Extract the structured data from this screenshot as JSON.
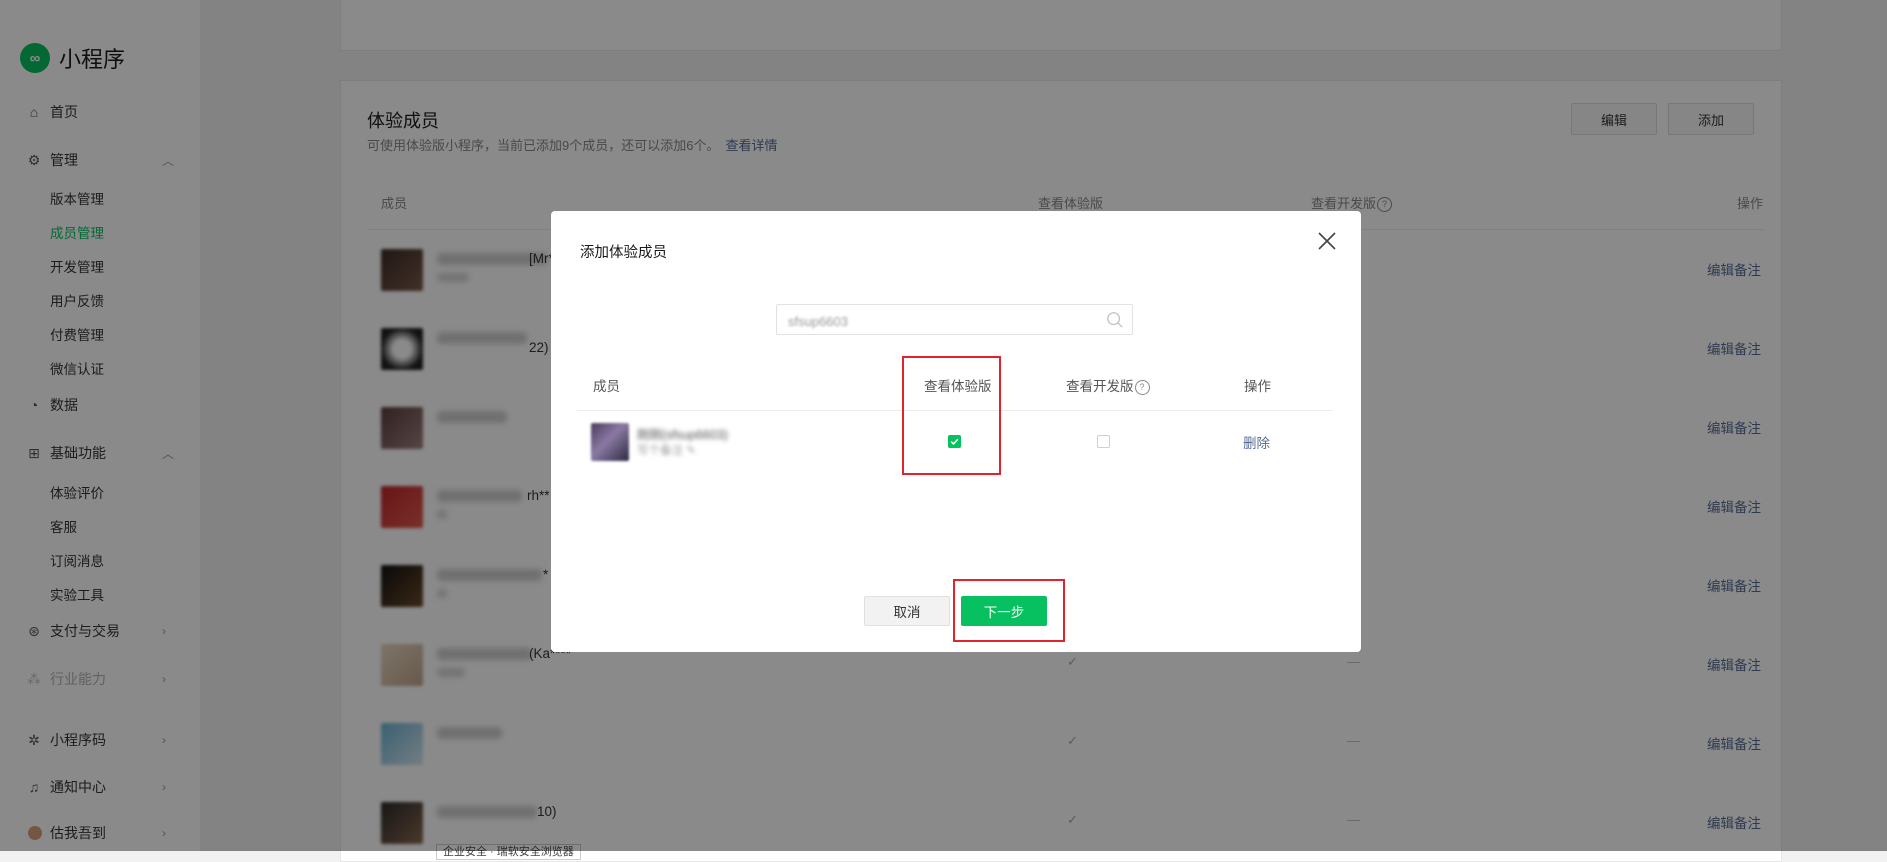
{
  "sidebar": {
    "app_name": "小程序",
    "nav": [
      {
        "label": "首页",
        "icon": "home-icon"
      },
      {
        "label": "管理",
        "icon": "settings-icon"
      },
      {
        "label": "数据",
        "icon": "chart-icon"
      },
      {
        "label": "基础功能",
        "icon": "grid-icon"
      },
      {
        "label": "支付与交易",
        "icon": "payment-icon"
      },
      {
        "label": "行业能力",
        "icon": "industry-icon"
      },
      {
        "label": "小程序码",
        "icon": "qrcode-icon"
      },
      {
        "label": "通知中心",
        "icon": "bell-icon"
      },
      {
        "label": "估我吾到",
        "icon": "avatar"
      }
    ],
    "manage_sub": [
      "版本管理",
      "成员管理",
      "开发管理",
      "用户反馈",
      "付费管理",
      "微信认证"
    ],
    "basic_sub": [
      "体验评价",
      "客服",
      "订阅消息",
      "实验工具"
    ]
  },
  "panel": {
    "title": "体验成员",
    "desc": "可使用体验版小程序，当前已添加9个成员，还可以添加6个。",
    "details_link": "查看详情",
    "edit_button": "编辑",
    "add_button": "添加",
    "columns": {
      "member": "成员",
      "view_trial": "查看体验版",
      "view_dev": "查看开发版",
      "action": "操作"
    },
    "row_action": "编辑备注",
    "row_tick": "✓",
    "row_dash": "—",
    "visible_name_fragments": [
      "[Mr*",
      "22)",
      "rh**",
      "*",
      "(Ka****",
      "10)"
    ],
    "tooltip": "企业安全 · 瑞软安全浏览器"
  },
  "modal": {
    "title": "添加体验成员",
    "search_value": "sfsup6603",
    "columns": {
      "member": "成员",
      "view_trial": "查看体验版",
      "view_dev": "查看开发版",
      "action": "操作"
    },
    "member_name": "刚刚(sfsup6603)",
    "member_remark": "写个备注 ✎",
    "view_trial_checked": true,
    "view_dev_checked": false,
    "delete_label": "删除",
    "cancel_label": "取消",
    "next_label": "下一步"
  },
  "colors": {
    "brand_green": "#07c160",
    "link_blue": "#576b95",
    "highlight_red": "#e0242b"
  }
}
